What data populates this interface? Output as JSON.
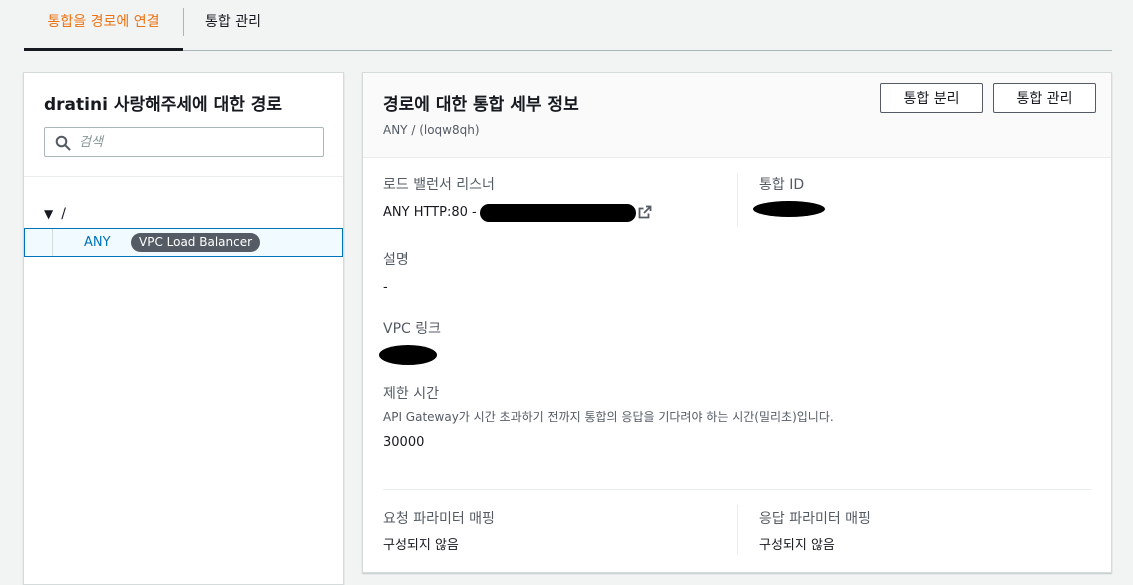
{
  "tabs": [
    {
      "label": "통합을 경로에 연결",
      "active": true
    },
    {
      "label": "통합 관리",
      "active": false
    }
  ],
  "left": {
    "title": "dratini 사랑해주세에 대한 경로",
    "search": {
      "placeholder": "검색",
      "value": ""
    },
    "tree": {
      "root": "/",
      "items": [
        {
          "method": "ANY",
          "badge": "VPC Load Balancer",
          "selected": true
        }
      ]
    }
  },
  "details": {
    "title": "경로에 대한 통합 세부 정보",
    "subtitle": "ANY / (loqw8qh)",
    "buttons": {
      "detach": "통합 분리",
      "manage": "통합 관리"
    },
    "listener": {
      "label": "로드 밸런서 리스너",
      "value": "ANY HTTP:80 -"
    },
    "integration_id": {
      "label": "통합 ID"
    },
    "description": {
      "label": "설명",
      "value": "-"
    },
    "vpc_link": {
      "label": "VPC 링크"
    },
    "timeout": {
      "label": "제한 시간",
      "help": "API Gateway가 시간 초과하기 전까지 통합의 응답을 기다려야 하는 시간(밀리초)입니다.",
      "value": "30000"
    },
    "request_mapping": {
      "label": "요청 파라미터 매핑",
      "value": "구성되지 않음"
    },
    "response_mapping": {
      "label": "응답 파라미터 매핑",
      "value": "구성되지 않음"
    }
  },
  "colors": {
    "accent": "#ec7211",
    "link": "#0073bb",
    "badge": "#545b64"
  }
}
